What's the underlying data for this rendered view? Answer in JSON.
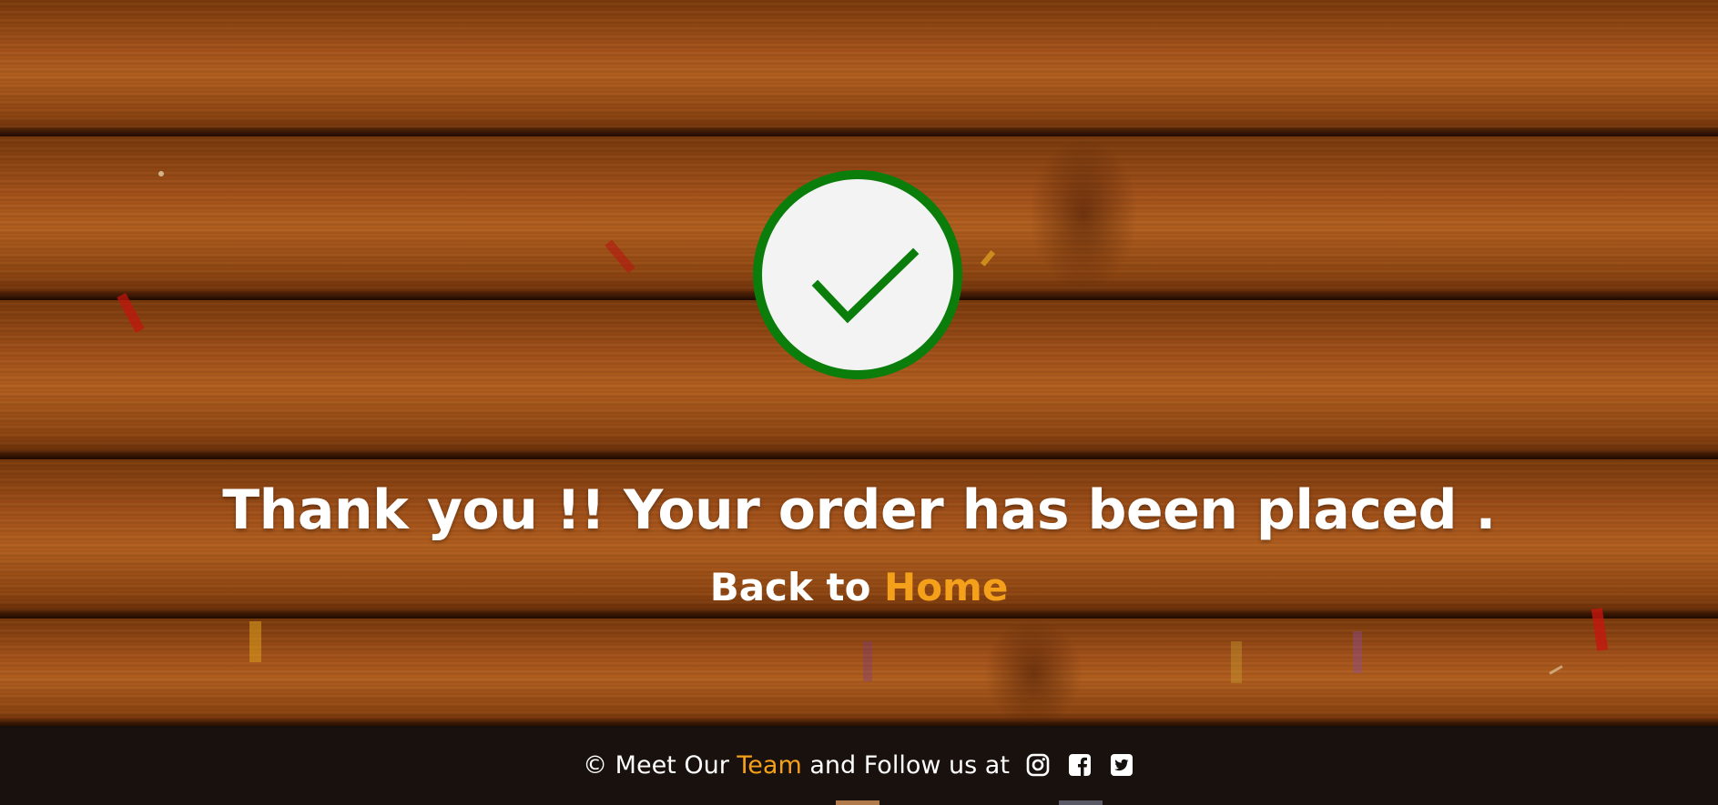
{
  "hero": {
    "headline": "Thank you !! Your order has been placed .",
    "back_prefix": "Back to ",
    "back_link": "Home"
  },
  "footer": {
    "copyright_prefix": "© Meet Our ",
    "team_link": "Team",
    "follow_text": " and Follow us at",
    "socials": [
      "instagram-icon",
      "facebook-icon",
      "twitter-icon"
    ]
  },
  "colors": {
    "accent": "#f5a01a",
    "check_green": "#0b7d0b",
    "circle_bg": "#f3f3f3",
    "footer_bg": "#14100e"
  }
}
